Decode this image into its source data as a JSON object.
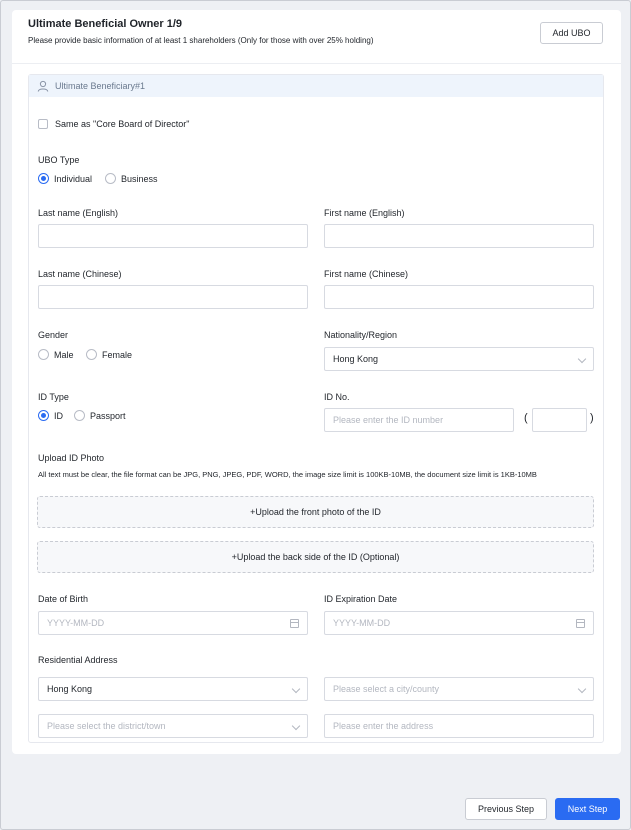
{
  "header": {
    "title": "Ultimate Beneficial Owner 1/9",
    "subtitle": "Please provide basic information of at least 1 shareholders (Only for those with over 25% holding)",
    "add_button": "Add UBO"
  },
  "ubo": {
    "section_title": "Ultimate Beneficiary#1",
    "same_as_label": "Same as \"Core Board of Director\"",
    "type_label": "UBO Type",
    "type_options": [
      "Individual",
      "Business"
    ],
    "type_selected": "Individual",
    "last_name_en_label": "Last name (English)",
    "first_name_en_label": "First name (English)",
    "last_name_cn_label": "Last name (Chinese)",
    "first_name_cn_label": "First name (Chinese)",
    "gender_label": "Gender",
    "gender_options": [
      "Male",
      "Female"
    ],
    "nationality_label": "Nationality/Region",
    "nationality_value": "Hong Kong",
    "id_type_label": "ID Type",
    "id_type_options": [
      "ID",
      "Passport"
    ],
    "id_type_selected": "ID",
    "id_no_label": "ID No.",
    "id_no_placeholder": "Please enter the ID number",
    "paren_open": "(",
    "paren_close": ")",
    "upload_label": "Upload ID Photo",
    "upload_hint": "All text must be clear, the file format can be JPG, PNG, JPEG, PDF, WORD, the image size limit is 100KB-10MB, the document size limit is 1KB-10MB",
    "upload_front": "+Upload the front photo of the ID",
    "upload_back": "+Upload the back side of the ID (Optional)",
    "dob_label": "Date of Birth",
    "dob_placeholder": "YYYY-MM-DD",
    "id_exp_label": "ID Expiration Date",
    "id_exp_placeholder": "YYYY-MM-DD",
    "address_label": "Residential Address",
    "address_region_value": "Hong Kong",
    "address_city_placeholder": "Please select a city/county",
    "address_district_placeholder": "Please select the district/town",
    "address_detail_placeholder": "Please enter the address"
  },
  "footer": {
    "prev": "Previous Step",
    "next": "Next Step"
  },
  "colors": {
    "accent": "#2a6bf2",
    "section_header_bg": "#eef4fc"
  }
}
